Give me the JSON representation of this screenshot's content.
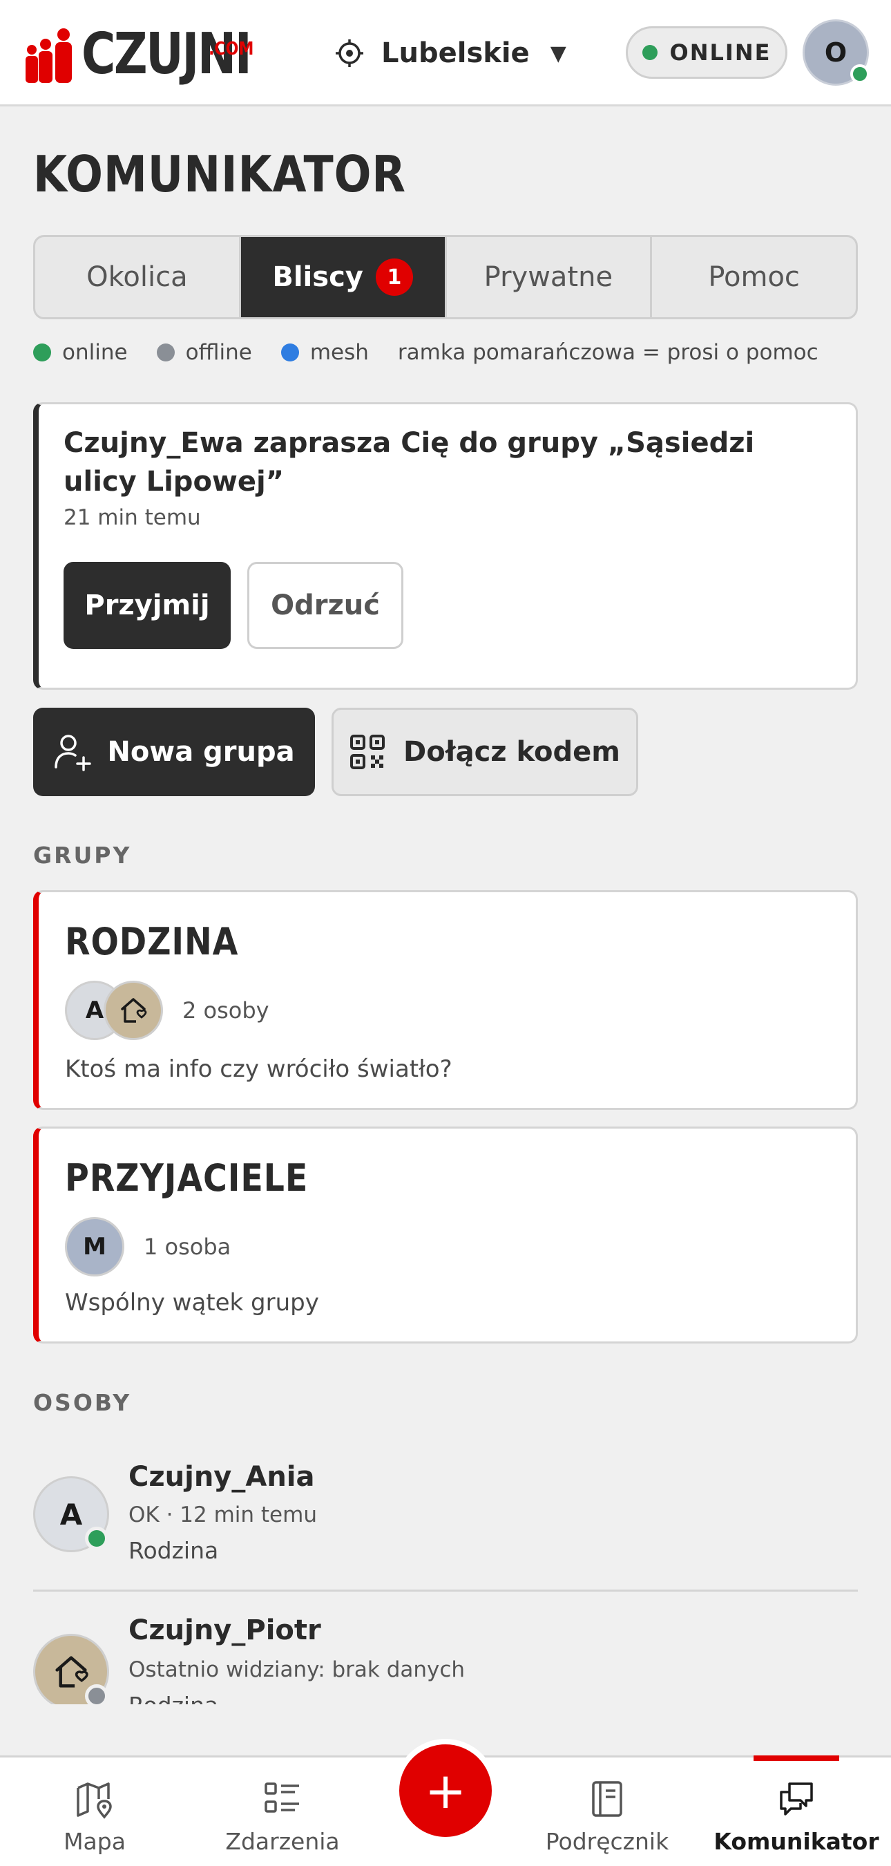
{
  "header": {
    "logo_text": "CZUJNI",
    "logo_suffix": ".COM",
    "region": "Lubelskie",
    "status": "ONLINE",
    "user_initial": "O"
  },
  "page": {
    "title": "KOMUNIKATOR"
  },
  "tabs": [
    {
      "label": "Okolica",
      "active": false
    },
    {
      "label": "Bliscy",
      "active": true,
      "badge": "1"
    },
    {
      "label": "Prywatne",
      "active": false
    },
    {
      "label": "Pomoc",
      "active": false
    }
  ],
  "legend": {
    "online": "online",
    "offline": "offline",
    "mesh": "mesh",
    "note": "ramka pomarańczowa = prosi o pomoc",
    "colors": {
      "online": "#2e9e5a",
      "offline": "#8a8f96",
      "mesh": "#2f7de1"
    }
  },
  "invite": {
    "text": "Czujny_Ewa zaprasza Cię do grupy „Sąsiedzi ulicy Lipowej”",
    "time": "21 min temu",
    "accept": "Przyjmij",
    "reject": "Odrzuć"
  },
  "actions": {
    "new_group": "Nowa grupa",
    "join_code": "Dołącz kodem"
  },
  "groups_label": "GRUPY",
  "groups": [
    {
      "name": "RODZINA",
      "avatars": [
        "A",
        "house-heart-icon"
      ],
      "count": "2 osoby",
      "message": "Ktoś ma info czy wróciło światło?"
    },
    {
      "name": "PRZYJACIELE",
      "avatars": [
        "M"
      ],
      "count": "1 osoba",
      "message": "Wspólny wątek grupy"
    }
  ],
  "people_label": "OSOBY",
  "people": [
    {
      "name": "Czujny_Ania",
      "initial": "A",
      "sub": "OK · 12 min temu",
      "group": "Rodzina",
      "status": "online"
    },
    {
      "name": "Czujny_Piotr",
      "initial": "",
      "sub": "Ostatnio widziany: brak danych",
      "group": "Rodzina",
      "status": "offline"
    }
  ],
  "nav": {
    "items": [
      {
        "label": "Mapa",
        "icon": "map-pin-icon"
      },
      {
        "label": "Zdarzenia",
        "icon": "list-icon"
      },
      {
        "label": "Podręcznik",
        "icon": "book-icon"
      },
      {
        "label": "Komunikator",
        "icon": "chat-icon",
        "active": true
      }
    ],
    "fab": "+"
  },
  "colors": {
    "accent": "#e00000",
    "dark": "#2d2d2d"
  }
}
